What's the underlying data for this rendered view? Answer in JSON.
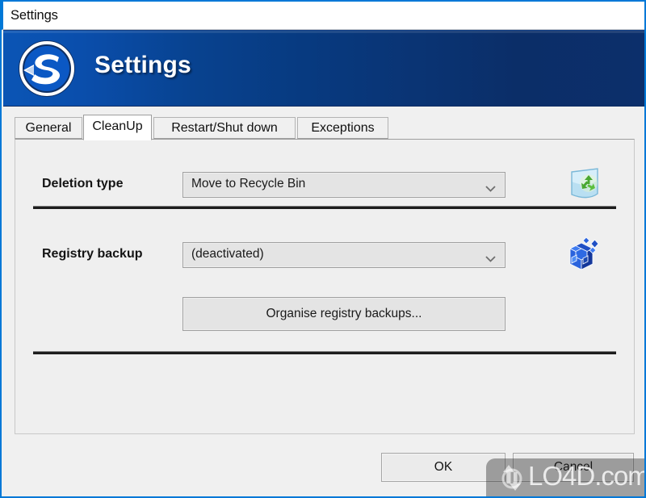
{
  "window": {
    "titlebar_text": "Settings",
    "banner_title": "Settings",
    "logo_icon": "s-circle-logo-icon",
    "accent_color": "#0078d7",
    "banner_gradient_start": "#0b55b5",
    "banner_gradient_end": "#0c2f6b"
  },
  "tabs": [
    {
      "label": "General",
      "active": false
    },
    {
      "label": "CleanUp",
      "active": true
    },
    {
      "label": "Restart/Shut down",
      "active": false
    },
    {
      "label": "Exceptions",
      "active": false
    }
  ],
  "content": {
    "deletion_type": {
      "label": "Deletion type",
      "value": "Move to Recycle Bin",
      "icon": "recycle-bin-icon",
      "arrow_icon": "chevron-down-icon"
    },
    "registry_backup": {
      "label": "Registry backup",
      "value": "(deactivated)",
      "icon": "registry-blocks-icon",
      "arrow_icon": "chevron-down-icon"
    },
    "organise_button": {
      "label": "Organise registry backups..."
    }
  },
  "footer": {
    "ok_label": "OK",
    "cancel_label": "Cancel"
  },
  "watermark": {
    "text": "LO4D.com",
    "logo_icon": "circular-arrows-icon"
  }
}
